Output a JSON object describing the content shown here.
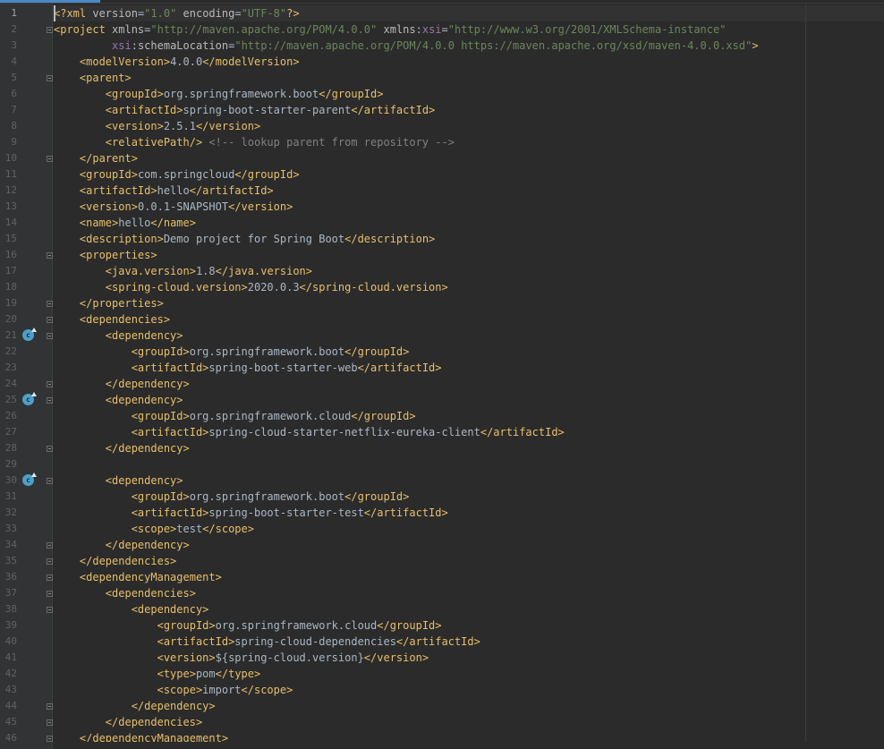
{
  "editor": {
    "file_type": "xml",
    "lines": [
      {
        "n": "1",
        "tokens": [
          [
            "tag",
            "<?xml "
          ],
          [
            "attr",
            "version"
          ],
          [
            "txt",
            "="
          ],
          [
            "str",
            "\"1.0\""
          ],
          [
            "attr",
            " encoding"
          ],
          [
            "txt",
            "="
          ],
          [
            "str",
            "\"UTF-8\""
          ],
          [
            "tag",
            "?>"
          ]
        ]
      },
      {
        "n": "2",
        "tokens": [
          [
            "tag",
            "<project "
          ],
          [
            "attr",
            "xmlns"
          ],
          [
            "txt",
            "="
          ],
          [
            "str",
            "\"http://maven.apache.org/POM/4.0.0\""
          ],
          [
            "attr",
            " xmlns"
          ],
          [
            "txt",
            ":"
          ],
          [
            "ns",
            "xsi"
          ],
          [
            "txt",
            "="
          ],
          [
            "str",
            "\"http://www.w3.org/2001/XMLSchema-instance\""
          ]
        ]
      },
      {
        "n": "3",
        "tokens": [
          [
            "txt",
            "         "
          ],
          [
            "ns",
            "xsi"
          ],
          [
            "txt",
            ":"
          ],
          [
            "attr",
            "schemaLocation"
          ],
          [
            "txt",
            "="
          ],
          [
            "str",
            "\"http://maven.apache.org/POM/4.0.0 https://maven.apache.org/xsd/maven-4.0.0.xsd\""
          ],
          [
            "tag",
            ">"
          ]
        ]
      },
      {
        "n": "4",
        "tokens": [
          [
            "txt",
            "    "
          ],
          [
            "tag",
            "<modelVersion>"
          ],
          [
            "txt",
            "4.0.0"
          ],
          [
            "tag",
            "</modelVersion>"
          ]
        ]
      },
      {
        "n": "5",
        "tokens": [
          [
            "txt",
            "    "
          ],
          [
            "tag",
            "<parent>"
          ]
        ]
      },
      {
        "n": "6",
        "tokens": [
          [
            "txt",
            "        "
          ],
          [
            "tag",
            "<groupId>"
          ],
          [
            "txt",
            "org.springframework.boot"
          ],
          [
            "tag",
            "</groupId>"
          ]
        ]
      },
      {
        "n": "7",
        "tokens": [
          [
            "txt",
            "        "
          ],
          [
            "tag",
            "<artifactId>"
          ],
          [
            "txt",
            "spring-boot-starter-parent"
          ],
          [
            "tag",
            "</artifactId>"
          ]
        ]
      },
      {
        "n": "8",
        "tokens": [
          [
            "txt",
            "        "
          ],
          [
            "tag",
            "<version>"
          ],
          [
            "txt",
            "2.5.1"
          ],
          [
            "tag",
            "</version>"
          ]
        ]
      },
      {
        "n": "9",
        "tokens": [
          [
            "txt",
            "        "
          ],
          [
            "tag",
            "<relativePath/>"
          ],
          [
            "com",
            " <!-- lookup parent from repository -->"
          ]
        ]
      },
      {
        "n": "10",
        "tokens": [
          [
            "txt",
            "    "
          ],
          [
            "tag",
            "</parent>"
          ]
        ]
      },
      {
        "n": "11",
        "tokens": [
          [
            "txt",
            "    "
          ],
          [
            "tag",
            "<groupId>"
          ],
          [
            "txt",
            "com.springcloud"
          ],
          [
            "tag",
            "</groupId>"
          ]
        ]
      },
      {
        "n": "12",
        "tokens": [
          [
            "txt",
            "    "
          ],
          [
            "tag",
            "<artifactId>"
          ],
          [
            "txt",
            "hello"
          ],
          [
            "tag",
            "</artifactId>"
          ]
        ]
      },
      {
        "n": "13",
        "tokens": [
          [
            "txt",
            "    "
          ],
          [
            "tag",
            "<version>"
          ],
          [
            "txt",
            "0.0.1-SNAPSHOT"
          ],
          [
            "tag",
            "</version>"
          ]
        ]
      },
      {
        "n": "14",
        "tokens": [
          [
            "txt",
            "    "
          ],
          [
            "tag",
            "<name>"
          ],
          [
            "txt",
            "hello"
          ],
          [
            "tag",
            "</name>"
          ]
        ]
      },
      {
        "n": "15",
        "tokens": [
          [
            "txt",
            "    "
          ],
          [
            "tag",
            "<description>"
          ],
          [
            "txt",
            "Demo project for Spring Boot"
          ],
          [
            "tag",
            "</description>"
          ]
        ]
      },
      {
        "n": "16",
        "tokens": [
          [
            "txt",
            "    "
          ],
          [
            "tag",
            "<properties>"
          ]
        ]
      },
      {
        "n": "17",
        "tokens": [
          [
            "txt",
            "        "
          ],
          [
            "tag",
            "<java.version>"
          ],
          [
            "txt",
            "1.8"
          ],
          [
            "tag",
            "</java.version>"
          ]
        ]
      },
      {
        "n": "18",
        "tokens": [
          [
            "txt",
            "        "
          ],
          [
            "tag",
            "<spring-cloud.version>"
          ],
          [
            "txt",
            "2020.0.3"
          ],
          [
            "tag",
            "</spring-cloud.version>"
          ]
        ]
      },
      {
        "n": "19",
        "tokens": [
          [
            "txt",
            "    "
          ],
          [
            "tag",
            "</properties>"
          ]
        ]
      },
      {
        "n": "20",
        "tokens": [
          [
            "txt",
            "    "
          ],
          [
            "tag",
            "<dependencies>"
          ]
        ]
      },
      {
        "n": "21",
        "tokens": [
          [
            "txt",
            "        "
          ],
          [
            "tag",
            "<dependency>"
          ]
        ]
      },
      {
        "n": "22",
        "tokens": [
          [
            "txt",
            "            "
          ],
          [
            "tag",
            "<groupId>"
          ],
          [
            "txt",
            "org.springframework.boot"
          ],
          [
            "tag",
            "</groupId>"
          ]
        ]
      },
      {
        "n": "23",
        "tokens": [
          [
            "txt",
            "            "
          ],
          [
            "tag",
            "<artifactId>"
          ],
          [
            "txt",
            "spring-boot-starter-web"
          ],
          [
            "tag",
            "</artifactId>"
          ]
        ]
      },
      {
        "n": "24",
        "tokens": [
          [
            "txt",
            "        "
          ],
          [
            "tag",
            "</dependency>"
          ]
        ]
      },
      {
        "n": "25",
        "tokens": [
          [
            "txt",
            "        "
          ],
          [
            "tag",
            "<dependency>"
          ]
        ]
      },
      {
        "n": "26",
        "tokens": [
          [
            "txt",
            "            "
          ],
          [
            "tag",
            "<groupId>"
          ],
          [
            "txt",
            "org.springframework.cloud"
          ],
          [
            "tag",
            "</groupId>"
          ]
        ]
      },
      {
        "n": "27",
        "tokens": [
          [
            "txt",
            "            "
          ],
          [
            "tag",
            "<artifactId>"
          ],
          [
            "txt",
            "spring-cloud-starter-netflix-eureka-client"
          ],
          [
            "tag",
            "</artifactId>"
          ]
        ]
      },
      {
        "n": "28",
        "tokens": [
          [
            "txt",
            "        "
          ],
          [
            "tag",
            "</dependency>"
          ]
        ]
      },
      {
        "n": "29",
        "tokens": []
      },
      {
        "n": "30",
        "tokens": [
          [
            "txt",
            "        "
          ],
          [
            "tag",
            "<dependency>"
          ]
        ]
      },
      {
        "n": "31",
        "tokens": [
          [
            "txt",
            "            "
          ],
          [
            "tag",
            "<groupId>"
          ],
          [
            "txt",
            "org.springframework.boot"
          ],
          [
            "tag",
            "</groupId>"
          ]
        ]
      },
      {
        "n": "32",
        "tokens": [
          [
            "txt",
            "            "
          ],
          [
            "tag",
            "<artifactId>"
          ],
          [
            "txt",
            "spring-boot-starter-test"
          ],
          [
            "tag",
            "</artifactId>"
          ]
        ]
      },
      {
        "n": "33",
        "tokens": [
          [
            "txt",
            "            "
          ],
          [
            "tag",
            "<scope>"
          ],
          [
            "txt",
            "test"
          ],
          [
            "tag",
            "</scope>"
          ]
        ]
      },
      {
        "n": "34",
        "tokens": [
          [
            "txt",
            "        "
          ],
          [
            "tag",
            "</dependency>"
          ]
        ]
      },
      {
        "n": "35",
        "tokens": [
          [
            "txt",
            "    "
          ],
          [
            "tag",
            "</dependencies>"
          ]
        ]
      },
      {
        "n": "36",
        "tokens": [
          [
            "txt",
            "    "
          ],
          [
            "tag",
            "<dependencyManagement>"
          ]
        ]
      },
      {
        "n": "37",
        "tokens": [
          [
            "txt",
            "        "
          ],
          [
            "tag",
            "<dependencies>"
          ]
        ]
      },
      {
        "n": "38",
        "tokens": [
          [
            "txt",
            "            "
          ],
          [
            "tag",
            "<dependency>"
          ]
        ]
      },
      {
        "n": "39",
        "tokens": [
          [
            "txt",
            "                "
          ],
          [
            "tag",
            "<groupId>"
          ],
          [
            "txt",
            "org.springframework.cloud"
          ],
          [
            "tag",
            "</groupId>"
          ]
        ]
      },
      {
        "n": "40",
        "tokens": [
          [
            "txt",
            "                "
          ],
          [
            "tag",
            "<artifactId>"
          ],
          [
            "txt",
            "spring-cloud-dependencies"
          ],
          [
            "tag",
            "</artifactId>"
          ]
        ]
      },
      {
        "n": "41",
        "tokens": [
          [
            "txt",
            "                "
          ],
          [
            "tag",
            "<version>"
          ],
          [
            "txt",
            "${spring-cloud.version}"
          ],
          [
            "tag",
            "</version>"
          ]
        ]
      },
      {
        "n": "42",
        "tokens": [
          [
            "txt",
            "                "
          ],
          [
            "tag",
            "<type>"
          ],
          [
            "txt",
            "pom"
          ],
          [
            "tag",
            "</type>"
          ]
        ]
      },
      {
        "n": "43",
        "tokens": [
          [
            "txt",
            "                "
          ],
          [
            "tag",
            "<scope>"
          ],
          [
            "txt",
            "import"
          ],
          [
            "tag",
            "</scope>"
          ]
        ]
      },
      {
        "n": "44",
        "tokens": [
          [
            "txt",
            "            "
          ],
          [
            "tag",
            "</dependency>"
          ]
        ]
      },
      {
        "n": "45",
        "tokens": [
          [
            "txt",
            "        "
          ],
          [
            "tag",
            "</dependencies>"
          ]
        ]
      },
      {
        "n": "46",
        "tokens": [
          [
            "txt",
            "    "
          ],
          [
            "tag",
            "</dependencyManagement>"
          ]
        ]
      }
    ],
    "fold_markers": [
      "2",
      "5",
      "10",
      "16",
      "19",
      "20",
      "21",
      "24",
      "25",
      "28",
      "30",
      "34",
      "35",
      "36",
      "37",
      "38",
      "44",
      "45",
      "46"
    ],
    "gutter_icons": [
      {
        "line": "21",
        "icon": "maven-dependency-update-icon",
        "glyph": "c"
      },
      {
        "line": "25",
        "icon": "maven-dependency-update-icon",
        "glyph": "c"
      },
      {
        "line": "30",
        "icon": "maven-dependency-update-icon",
        "glyph": "c"
      }
    ],
    "current_line": "1",
    "colors": {
      "background": "#2b2b2b",
      "gutter": "#313335",
      "tag": "#e8bf6a",
      "attribute": "#bababa",
      "namespace": "#9876aa",
      "string": "#6a8759",
      "comment": "#808080",
      "text": "#a9b7c6"
    }
  }
}
